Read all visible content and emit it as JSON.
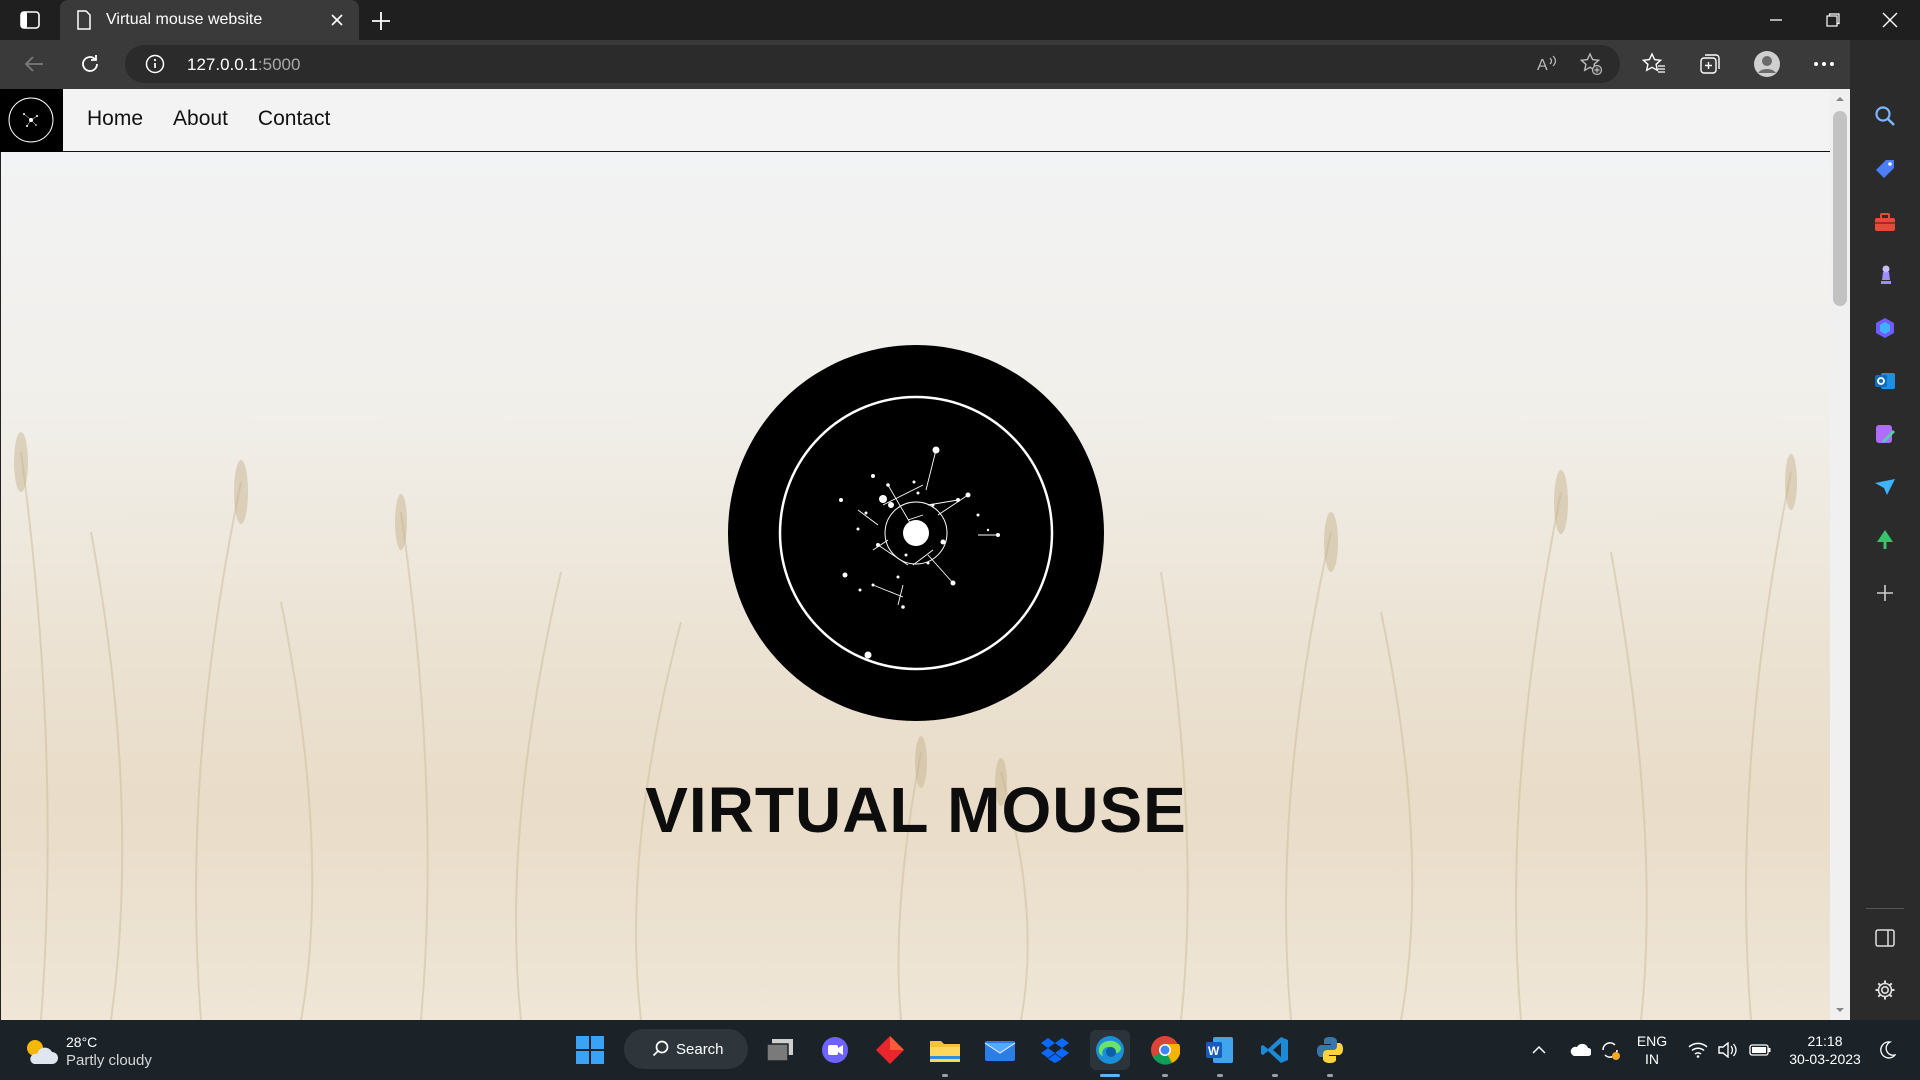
{
  "browser": {
    "tab_title": "Virtual mouse website",
    "url_host": "127.0.0.1",
    "url_port": ":5000"
  },
  "page": {
    "nav_links": [
      "Home",
      "About",
      "Contact"
    ],
    "hero_title": "VIRTUAL MOUSE"
  },
  "taskbar": {
    "weather_temp": "28°C",
    "weather_desc": "Partly cloudy",
    "search_label": "Search",
    "lang_top": "ENG",
    "lang_bottom": "IN",
    "time": "21:18",
    "date": "30-03-2023"
  }
}
